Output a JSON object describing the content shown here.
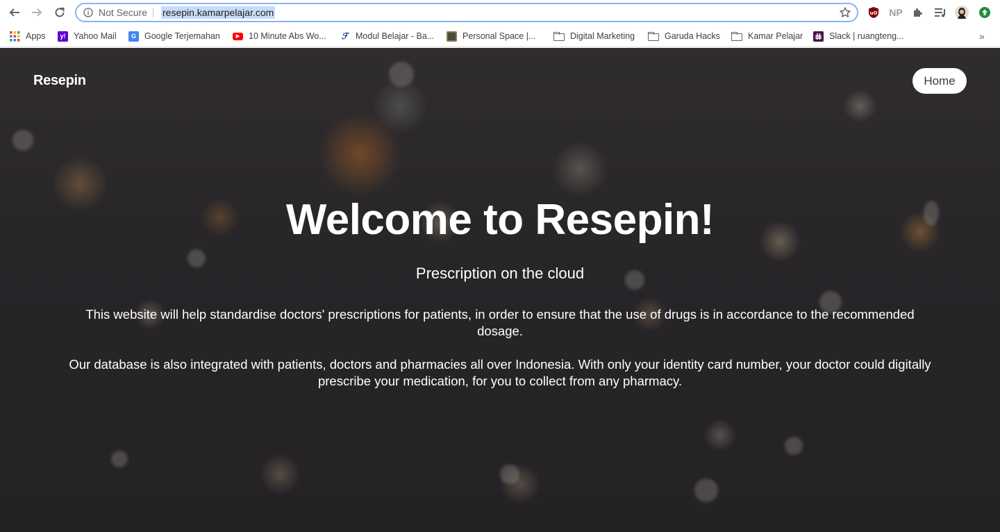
{
  "browser": {
    "security_label": "Not Secure",
    "url": "resepin.kamarpelajar.com",
    "extensions": [
      "ublock-icon",
      "np-icon",
      "puzzle-icon",
      "media-icon",
      "profile-avatar",
      "update-icon"
    ],
    "np_label": "NP"
  },
  "bookmarks": [
    {
      "label": "Apps",
      "icon": "apps-grid-icon"
    },
    {
      "label": "Yahoo Mail",
      "icon": "yahoo-icon"
    },
    {
      "label": "Google Terjemahan",
      "icon": "google-translate-icon"
    },
    {
      "label": "10 Minute Abs Wo...",
      "icon": "youtube-icon"
    },
    {
      "label": "Modul Belajar - Ba...",
      "icon": "modul-icon"
    },
    {
      "label": "Personal Space |...",
      "icon": "personal-space-icon"
    },
    {
      "label": "Digital Marketing",
      "icon": "folder-icon"
    },
    {
      "label": "Garuda Hacks",
      "icon": "folder-icon"
    },
    {
      "label": "Kamar Pelajar",
      "icon": "folder-icon"
    },
    {
      "label": "Slack | ruangteng...",
      "icon": "slack-icon"
    }
  ],
  "page": {
    "brand": "Resepin",
    "nav": {
      "home_label": "Home"
    },
    "hero": {
      "title": "Welcome to Resepin!",
      "subtitle": "Prescription on the cloud",
      "paragraph_1": "This website will help standardise doctors' prescriptions for patients, in order to ensure that the use of drugs is in accordance to the recommended dosage.",
      "paragraph_2": "Our database is also integrated with patients, doctors and pharmacies all over Indonesia. With only your identity card number, your doctor could digitally prescribe your medication, for you to collect from any pharmacy."
    }
  },
  "colors": {
    "omnibox_border": "#8ab4f8",
    "url_highlight": "#c6dcf7",
    "hero_text": "#ffffff",
    "home_button_bg": "#ffffff"
  }
}
